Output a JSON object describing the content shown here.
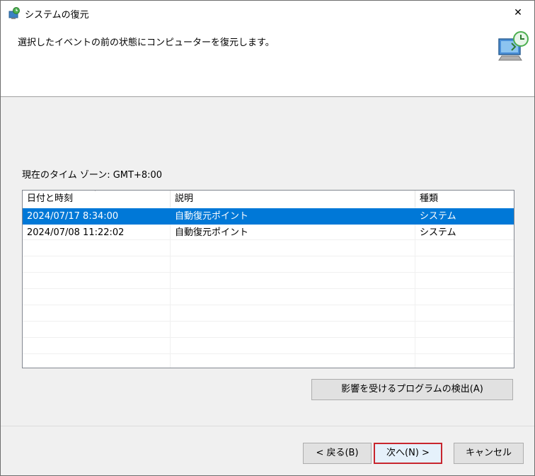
{
  "window": {
    "title": "システムの復元",
    "close_glyph": "✕"
  },
  "header": {
    "instruction": "選択したイベントの前の状態にコンピューターを復元します。"
  },
  "timezone_label": "現在のタイム ゾーン: GMT+8:00",
  "table": {
    "columns": [
      "日付と時刻",
      "説明",
      "種類"
    ],
    "rows": [
      {
        "date": "2024/07/17 8:34:00",
        "description": "自動復元ポイント",
        "type": "システム",
        "selected": true
      },
      {
        "date": "2024/07/08 11:22:02",
        "description": "自動復元ポイント",
        "type": "システム",
        "selected": false
      }
    ]
  },
  "buttons": {
    "scan": "影響を受けるプログラムの検出(A)",
    "back": "< 戻る(B)",
    "next": "次へ(N) >",
    "cancel": "キャンセル"
  },
  "colors": {
    "selection": "#0078d7",
    "default_button_border": "#c8262e"
  },
  "icons": {
    "title": "system-restore-icon",
    "header": "computer-restore-icon",
    "sort": "sort-down-icon"
  }
}
